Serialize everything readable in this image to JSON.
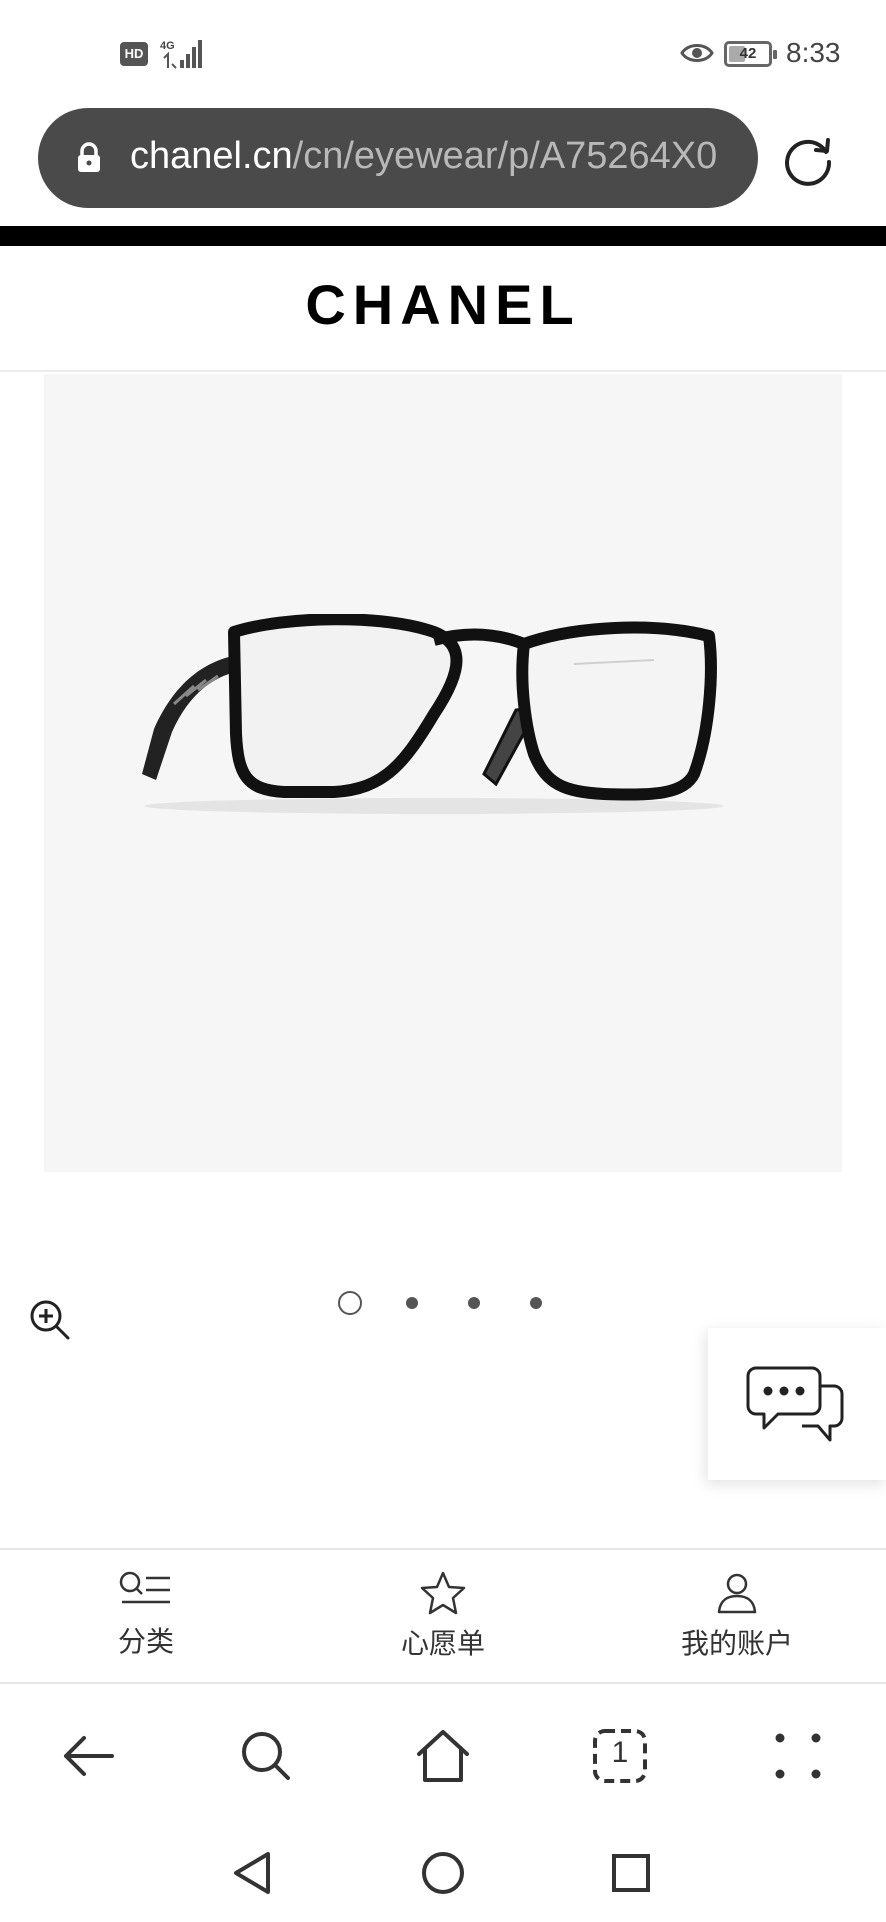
{
  "status_bar": {
    "hd_badge": "HD",
    "network": "4G",
    "battery_level": "42",
    "battery_fraction": 0.42,
    "time": "8:33"
  },
  "browser": {
    "url_domain": "chanel.cn",
    "url_path": "/cn/eyewear/p/A75264X0",
    "tab_count": "1"
  },
  "site": {
    "logo": "CHANEL"
  },
  "product": {
    "image_subject": "eyeglasses",
    "carousel_total": 4,
    "carousel_active": 0
  },
  "bottom_nav": {
    "items": [
      {
        "label": "分类",
        "icon": "category-list-icon"
      },
      {
        "label": "心愿单",
        "icon": "star-icon"
      },
      {
        "label": "我的账户",
        "icon": "user-icon"
      }
    ]
  },
  "toolbar": {
    "buttons": [
      "back-icon",
      "search-icon",
      "home-icon",
      "tabs-icon",
      "more-icon"
    ]
  },
  "system_nav": {
    "buttons": [
      "back-triangle-icon",
      "home-circle-icon",
      "recents-square-icon"
    ]
  },
  "colors": {
    "url_bar_bg": "#4a4a4a",
    "header_bar": "#000000",
    "image_bg": "#f6f6f6"
  }
}
